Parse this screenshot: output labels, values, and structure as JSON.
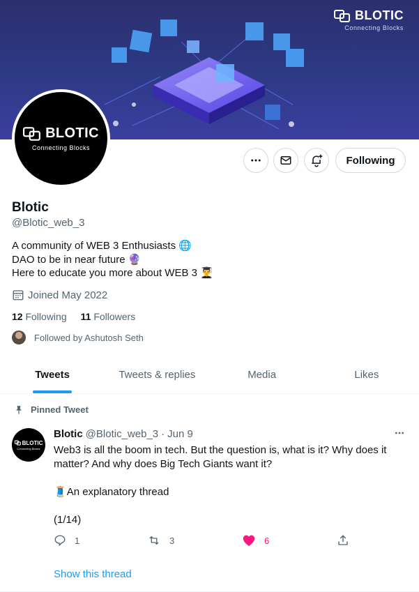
{
  "banner": {
    "brand_word": "BLOTIC",
    "brand_tagline": "Connecting Blocks"
  },
  "avatar": {
    "brand_word": "BLOTIC",
    "brand_tagline": "Connecting Blocks"
  },
  "actions": {
    "following_label": "Following"
  },
  "profile": {
    "name": "Blotic",
    "handle": "@Blotic_web_3",
    "bio": [
      {
        "text": "A community of WEB 3 Enthusiasts",
        "emoji": "🌐"
      },
      {
        "text": "DAO to be in near future",
        "emoji": "🔮"
      },
      {
        "text": "Here to educate you more about WEB 3",
        "emoji": "👨‍🎓"
      }
    ],
    "joined": "Joined May 2022",
    "following_count": "12",
    "following_label": "Following",
    "followers_count": "11",
    "followers_label": "Followers",
    "followed_by": "Followed by Ashutosh Seth"
  },
  "tabs": [
    "Tweets",
    "Tweets & replies",
    "Media",
    "Likes"
  ],
  "tweet": {
    "pinned_label": "Pinned Tweet",
    "author_name": "Blotic",
    "author_handle": "@Blotic_web_3",
    "separator": "·",
    "date": "Jun 9",
    "avatar_word": "BLOTIC",
    "avatar_tagline": "Connecting Blocks",
    "paragraph_1": "Web3 is all the boom in tech. But the question is, what is it? Why does it matter? And why does Big Tech Giants want it?",
    "thread_emoji": "🧵",
    "paragraph_2": "An explanatory thread",
    "paragraph_3": "(1/14)",
    "reply_count": "1",
    "retweet_count": "3",
    "like_count": "6",
    "show_thread": "Show this thread"
  },
  "colors": {
    "accent": "#1d9bf0",
    "like": "#f91880",
    "muted": "#536471"
  }
}
